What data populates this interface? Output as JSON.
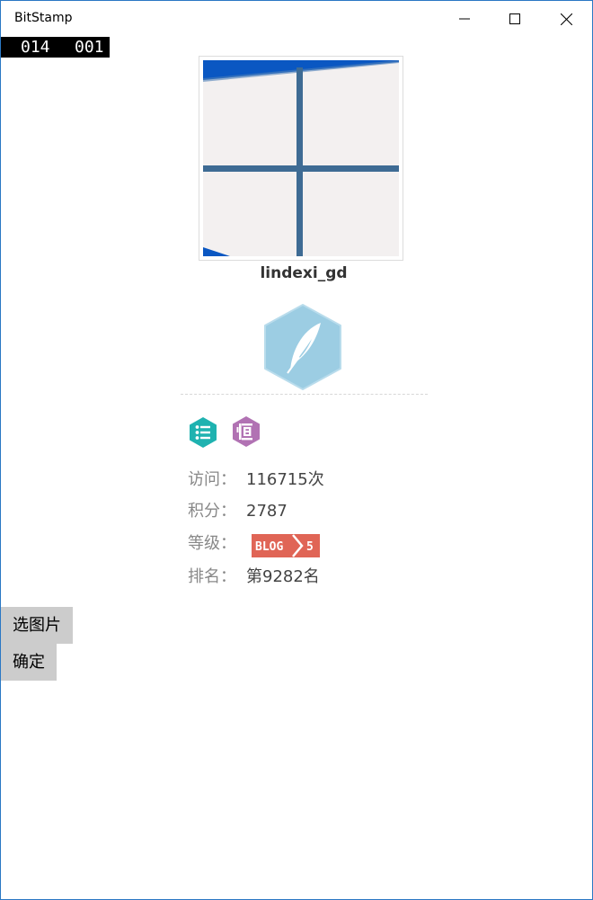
{
  "window": {
    "title": "BitStamp"
  },
  "frame_counter": {
    "left": "014",
    "right": "001"
  },
  "profile": {
    "username": "lindexi_gd",
    "stats": [
      {
        "label": "访问：",
        "value": "116715次"
      },
      {
        "label": "积分：",
        "value": "2787"
      },
      {
        "label": "等级：",
        "badge": "BLOG 5"
      },
      {
        "label": "排名：",
        "value": "第9282名"
      }
    ]
  },
  "buttons": {
    "pick_image": "选图片",
    "confirm": "确定"
  },
  "icons": {
    "avatar": "windows-logo-icon",
    "level": "feather-icon",
    "list": "list-icon",
    "medal": "medal-icon",
    "minimize": "minimize-icon",
    "maximize": "maximize-icon",
    "close": "close-icon"
  },
  "colors": {
    "level_hex": "#9ccde3",
    "list_icon": "#1fb2b0",
    "medal_icon": "#b172b3",
    "blog_badge": "#e06556",
    "button_bg": "#cccccc"
  }
}
